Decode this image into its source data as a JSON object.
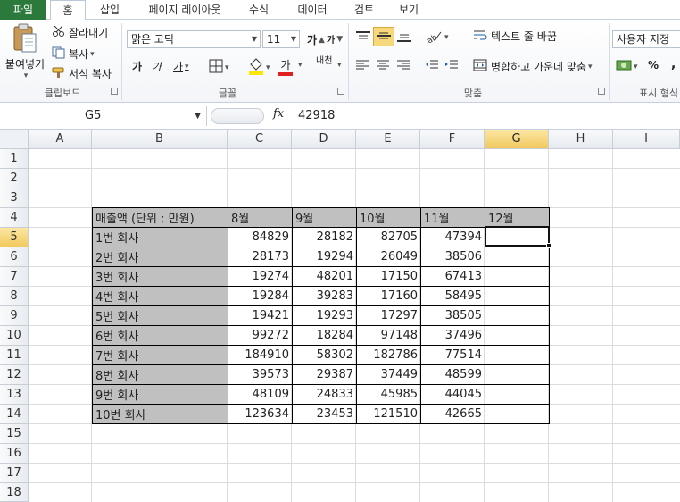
{
  "tabs": [
    "파일",
    "홈",
    "삽입",
    "페이지 레이아웃",
    "수식",
    "데이터",
    "검토",
    "보기"
  ],
  "active_tab": "홈",
  "clipboard": {
    "paste": "붙여넣기",
    "cut": "잘라내기",
    "copy": "복사",
    "format_painter": "서식 복사",
    "group": "클립보드"
  },
  "font": {
    "name": "맑은 고딕",
    "size": "11",
    "grow": "가",
    "shrink": "가",
    "bold": "가",
    "italic": "가",
    "underline": "가",
    "font_color_glyph": "가",
    "phonetic": "내천",
    "group": "글꼴"
  },
  "alignment": {
    "wrap_text": "텍스트 줄 바꿈",
    "merge_center": "병합하고 가운데 맞춤",
    "group": "맞춤"
  },
  "number": {
    "format": "사용자 지정",
    "percent": "%",
    "comma": ",",
    "group": "표시 형식"
  },
  "formula_bar": {
    "name_box": "G5",
    "fx": "fx",
    "value": "42918"
  },
  "columns": [
    "A",
    "B",
    "C",
    "D",
    "E",
    "F",
    "G",
    "H",
    "I"
  ],
  "rows": [
    "1",
    "2",
    "3",
    "4",
    "5",
    "6",
    "7",
    "8",
    "9",
    "10",
    "11",
    "12",
    "13",
    "14",
    "15",
    "16",
    "17",
    "18"
  ],
  "selected_column": "G",
  "selected_row": "5",
  "table": {
    "header": [
      "매출액 (단위 : 만원)",
      "8월",
      "9월",
      "10월",
      "11월",
      "12월"
    ],
    "rows": [
      [
        "1번 회사",
        "84829",
        "28182",
        "82705",
        "47394",
        ""
      ],
      [
        "2번 회사",
        "28173",
        "19294",
        "26049",
        "38506",
        ""
      ],
      [
        "3번 회사",
        "19274",
        "48201",
        "17150",
        "67413",
        ""
      ],
      [
        "4번 회사",
        "19284",
        "39283",
        "17160",
        "58495",
        ""
      ],
      [
        "5번 회사",
        "19421",
        "19293",
        "17297",
        "38505",
        ""
      ],
      [
        "6번 회사",
        "99272",
        "18284",
        "97148",
        "37496",
        ""
      ],
      [
        "7번 회사",
        "184910",
        "58302",
        "182786",
        "77514",
        ""
      ],
      [
        "8번 회사",
        "39573",
        "29387",
        "37449",
        "48599",
        ""
      ],
      [
        "9번 회사",
        "48109",
        "24833",
        "45985",
        "44045",
        ""
      ],
      [
        "10번 회사",
        "123634",
        "23453",
        "121510",
        "42665",
        ""
      ]
    ]
  },
  "colors": {
    "file_tab": "#2b7a3c",
    "header_fill": "#c0c0c0",
    "selection_header": "#f2c95e",
    "font_color_bar": "#e02020",
    "highlight_bar": "#ffe600"
  }
}
